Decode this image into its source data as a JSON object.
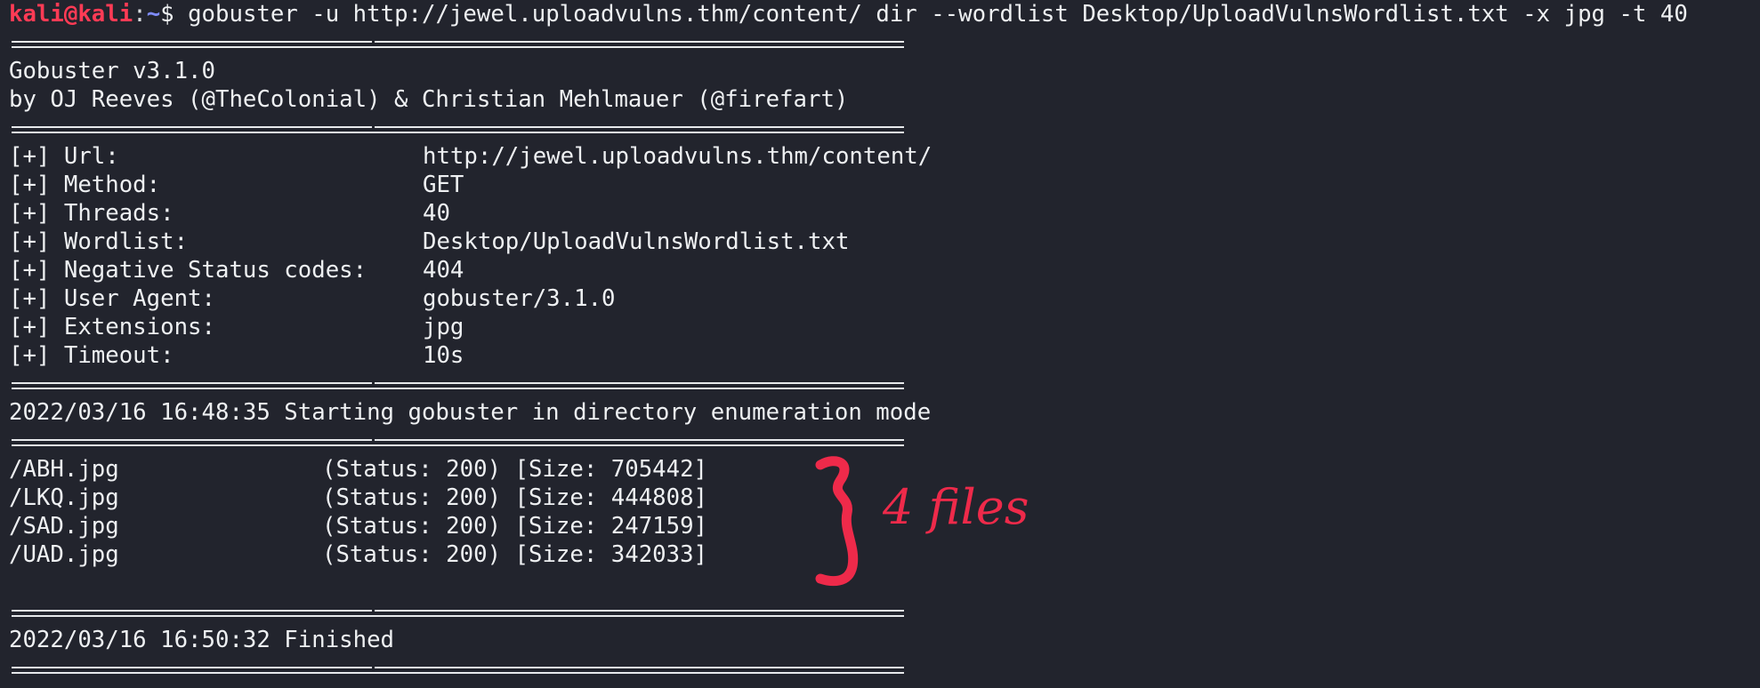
{
  "prompt": {
    "user": "kali",
    "at": "@",
    "host": "kali",
    "sep": ":",
    "cwd": "~",
    "symbol": "$",
    "command": "gobuster -u http://jewel.uploadvulns.thm/content/ dir --wordlist Desktop/UploadVulnsWordlist.txt -x jpg -t 40"
  },
  "banner": {
    "version": "Gobuster v3.1.0",
    "authors": "by OJ Reeves (@TheColonial) & Christian Mehlmauer (@firefart)"
  },
  "options": [
    {
      "key": "[+] Url:",
      "value": "http://jewel.uploadvulns.thm/content/"
    },
    {
      "key": "[+] Method:",
      "value": "GET"
    },
    {
      "key": "[+] Threads:",
      "value": "40"
    },
    {
      "key": "[+] Wordlist:",
      "value": "Desktop/UploadVulnsWordlist.txt"
    },
    {
      "key": "[+] Negative Status codes:",
      "value": "404"
    },
    {
      "key": "[+] User Agent:",
      "value": "gobuster/3.1.0"
    },
    {
      "key": "[+] Extensions:",
      "value": "jpg"
    },
    {
      "key": "[+] Timeout:",
      "value": "10s"
    }
  ],
  "start_line": "2022/03/16 16:48:35 Starting gobuster in directory enumeration mode",
  "results": [
    {
      "path": "/ABH.jpg",
      "info": "(Status: 200) [Size: 705442]"
    },
    {
      "path": "/LKQ.jpg",
      "info": "(Status: 200) [Size: 444808]"
    },
    {
      "path": "/SAD.jpg",
      "info": "(Status: 200) [Size: 247159]"
    },
    {
      "path": "/UAD.jpg",
      "info": "(Status: 200) [Size: 342033]"
    }
  ],
  "finish_line": "2022/03/16 16:50:32 Finished",
  "annotation": {
    "text": "4 files",
    "color": "#ee2a4a"
  },
  "colors": {
    "background": "#22242d",
    "text": "#eef0f2",
    "prompt_user": "#ff3b55",
    "prompt_cwd": "#7f8cff"
  }
}
